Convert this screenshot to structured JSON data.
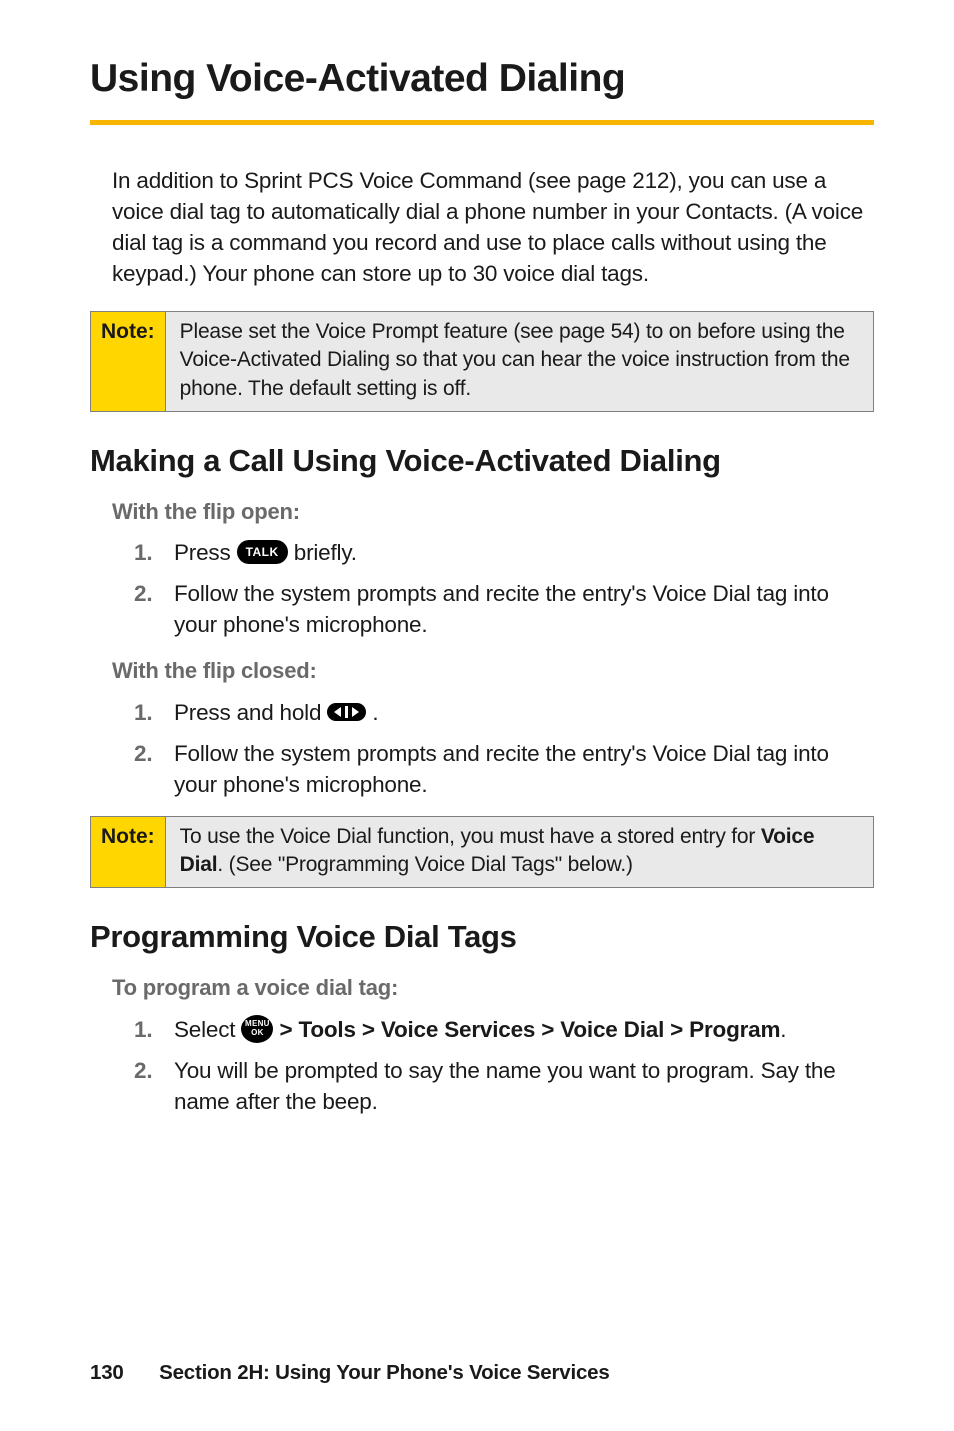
{
  "title": "Using Voice-Activated Dialing",
  "intro": "In addition to Sprint PCS Voice Command (see page 212), you can use a voice dial tag to automatically dial a phone number in your Contacts. (A voice dial tag is a command you record and use to place calls without using the keypad.) Your phone can store up to 30 voice dial tags.",
  "note1_label": "Note:",
  "note1_body": "Please set the Voice Prompt feature (see page 54) to on before using the Voice-Activated Dialing so that you can hear the voice instruction from the phone. The default setting is off.",
  "h2_making": "Making a Call Using Voice-Activated Dialing",
  "flip_open_label": "With the flip open:",
  "icons": {
    "talk": "TALK",
    "menu_top": "MENU",
    "menu_bottom": "OK"
  },
  "fo_item1_pre": "Press ",
  "fo_item1_post": " briefly.",
  "fo_item2": "Follow the system prompts and recite the entry's Voice Dial tag into your phone's microphone.",
  "flip_closed_label": "With the flip closed:",
  "fc_item1_pre": "Press and hold ",
  "fc_item1_post": " .",
  "fc_item2": "Follow the system prompts and recite the entry's Voice Dial tag into your phone's microphone.",
  "note2_label": "Note:",
  "note2_body_pre": "To use the Voice Dial function, you must have a stored entry for ",
  "note2_body_bold": "Voice Dial",
  "note2_body_post": ". (See \"Programming Voice Dial Tags\" below.)",
  "h2_program": "Programming Voice Dial Tags",
  "program_label": "To program a voice dial tag:",
  "prog_item1_pre": "Select ",
  "prog_item1_path": " > Tools > Voice Services > Voice Dial > Program",
  "prog_item1_post": ".",
  "prog_item2": "You will be prompted to say the name you want to program. Say the name after the beep.",
  "nums": {
    "one": "1.",
    "two": "2."
  },
  "footer_page": "130",
  "footer_text": "Section 2H: Using Your Phone's Voice Services"
}
